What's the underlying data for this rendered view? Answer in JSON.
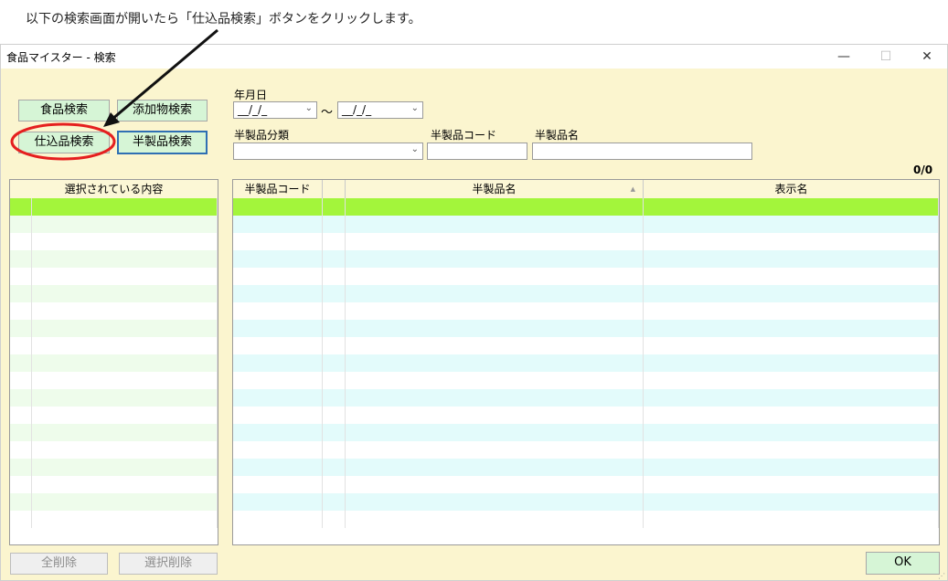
{
  "annotation": {
    "text": "以下の検索画面が開いたら「仕込品検索」ボタンをクリックします。"
  },
  "window": {
    "title": "食品マイスター - 検索",
    "controls": {
      "minimize": "—",
      "maximize": "☐",
      "close": "✕"
    }
  },
  "search_buttons": {
    "food": "食品検索",
    "additive": "添加物検索",
    "prep": "仕込品検索",
    "semi": "半製品検索"
  },
  "filters": {
    "date_label": "年月日",
    "date_from": "__/_/_",
    "date_to": "__/_/_",
    "tilde": "～",
    "category_label": "半製品分類",
    "category_value": "",
    "code_label": "半製品コード",
    "code_value": "",
    "name_label": "半製品名",
    "name_value": ""
  },
  "count": "0/0",
  "selected_panel": {
    "header": "選択されている内容"
  },
  "results": {
    "columns": [
      "半製品コード",
      "",
      "半製品名",
      "表示名"
    ],
    "sort_indicator": "▲"
  },
  "footer": {
    "clear_all": "全削除",
    "clear_selected": "選択削除",
    "ok": "OK"
  },
  "colors": {
    "window_bg": "#fbf5cf",
    "button_green": "#d6f5d6",
    "selected_row": "#a3f53b",
    "alt_row": "#e3fbfb",
    "left_alt_row": "#eefceb",
    "highlight_circle": "#e51f1f"
  }
}
